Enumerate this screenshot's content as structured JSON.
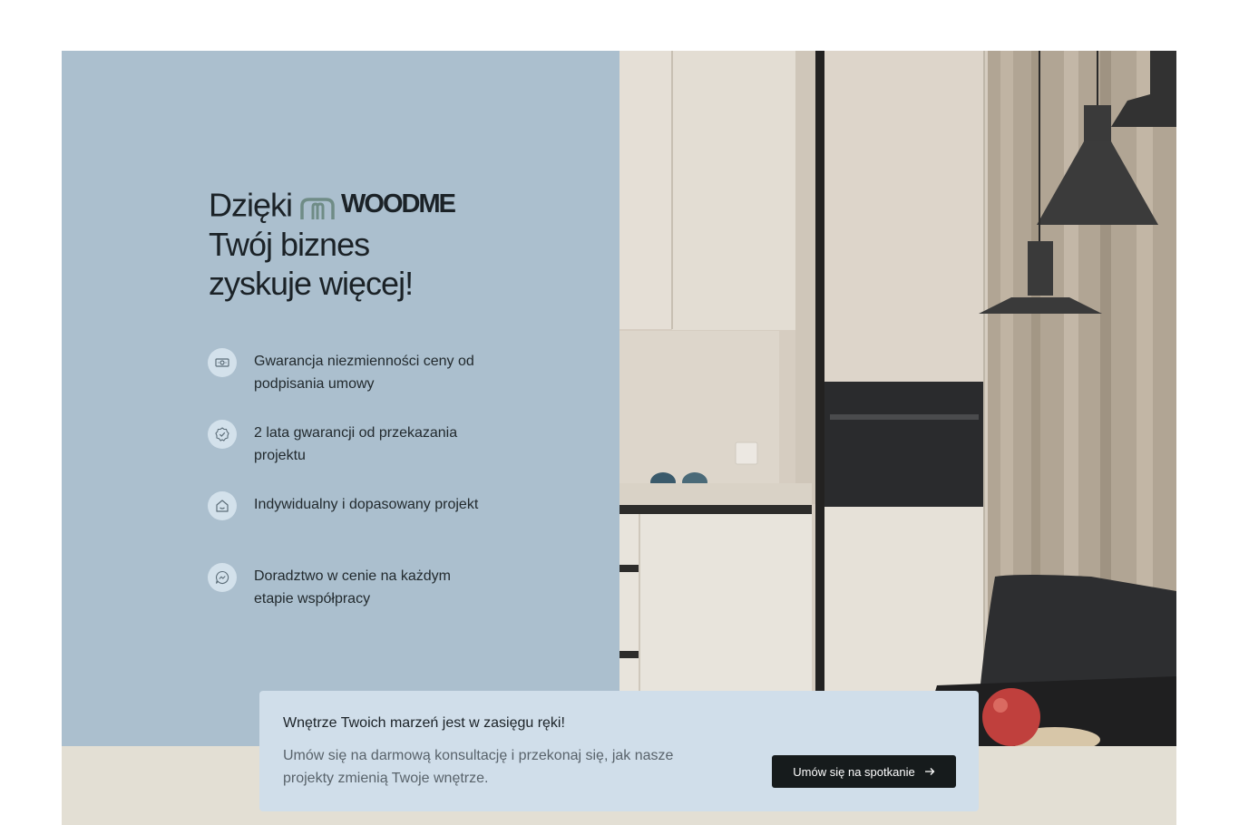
{
  "hero": {
    "headline": {
      "prefix": "Dzięki",
      "brand_name": "WOODME",
      "line2": "Twój biznes",
      "line3": "zyskuje więcej!"
    },
    "benefits": [
      {
        "icon": "price-tag-icon",
        "text": "Gwarancja niezmienności ceny od podpisania umowy"
      },
      {
        "icon": "badge-check-icon",
        "text": "2 lata gwarancji od przekazania projektu"
      },
      {
        "icon": "home-icon",
        "text": "Indywidualny i dopasowany projekt"
      },
      {
        "icon": "chat-bubble-icon",
        "text": "Doradztwo w cenie na każdym etapie współpracy"
      }
    ],
    "image": {
      "subject": "kitchen-interior-photo"
    }
  },
  "cta": {
    "title": "Wnętrze Twoich marzeń jest w zasięgu ręki!",
    "description": "Umów się na darmową konsultację i przekonaj się, jak nasze projekty zmienią Twoje wnętrze.",
    "button_label": "Umów się na spotkanie",
    "button_icon": "arrow-right-icon"
  },
  "colors": {
    "left_panel": "#abbfce",
    "cta_card": "#d0deea",
    "button": "#161b1c",
    "bottom_band": "#e3dfd4",
    "brand_icon": "#6f8c86"
  }
}
